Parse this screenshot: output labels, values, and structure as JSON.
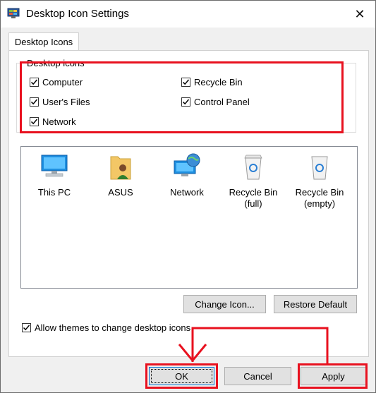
{
  "window": {
    "title": "Desktop Icon Settings",
    "close_glyph": "✕"
  },
  "tabs": [
    {
      "label": "Desktop Icons",
      "selected": true
    }
  ],
  "group": {
    "label": "Desktop icons"
  },
  "checkboxes": [
    {
      "label": "Computer",
      "checked": true
    },
    {
      "label": "Recycle Bin",
      "checked": true
    },
    {
      "label": "User's Files",
      "checked": true
    },
    {
      "label": "Control Panel",
      "checked": true
    },
    {
      "label": "Network",
      "checked": true
    }
  ],
  "icons": [
    {
      "label": "This PC",
      "icon": "computer-icon"
    },
    {
      "label": "ASUS",
      "icon": "user-folder-icon"
    },
    {
      "label": "Network",
      "icon": "network-icon"
    },
    {
      "label": "Recycle Bin\n(full)",
      "icon": "recycle-bin-full-icon"
    },
    {
      "label": "Recycle Bin\n(empty)",
      "icon": "recycle-bin-empty-icon"
    }
  ],
  "buttons": {
    "change_icon": "Change Icon...",
    "restore_default": "Restore Default",
    "ok": "OK",
    "cancel": "Cancel",
    "apply": "Apply"
  },
  "allow_themes": {
    "label": "Allow themes to change desktop icons",
    "checked": true
  },
  "colors": {
    "annotation": "#e8111f",
    "accent": "#0078d7"
  }
}
